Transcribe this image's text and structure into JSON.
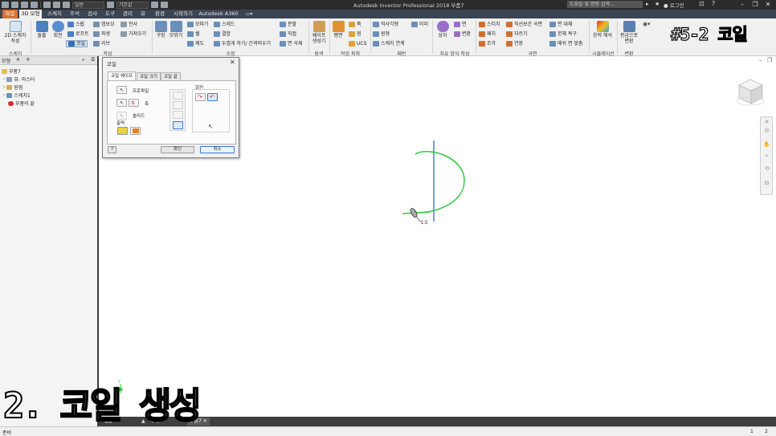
{
  "titlebar": {
    "app_title": "Autodesk Inventor Professional 2018    부품7",
    "material_combo": "일반",
    "appearance_combo": "기본값",
    "help_search_placeholder": "도움말 및 명령 검색...",
    "login_label": "로그인",
    "icons": [
      "file-icon",
      "save-icon",
      "undo-icon",
      "redo-icon",
      "home-icon",
      "folder-icon",
      "material-icon",
      "appearance-icon",
      "help-icon",
      "minimize-icon",
      "restore-icon",
      "close-icon"
    ]
  },
  "menubar": {
    "tabs": [
      "파일",
      "3D 모형",
      "스케치",
      "주석",
      "검사",
      "도구",
      "관리",
      "뷰",
      "환경",
      "시작하기",
      "Autodesk A360"
    ]
  },
  "ribbon": {
    "groups": {
      "sketch": {
        "label": "스케치",
        "sketch2d": "2D 스케치 작성"
      },
      "create": {
        "label": "작성",
        "extrude": "돌출",
        "revolve": "회전",
        "sweep": "스윕",
        "loft": "로프트",
        "coil": "코일",
        "emboss": "엠보싱",
        "derive": "파생",
        "rib": "리브",
        "decal": "전사",
        "import": "가져오기"
      },
      "modify": {
        "label": "수정",
        "hole": "구멍",
        "fillet": "모깎기",
        "chamfer": "모따기",
        "shell": "쉘",
        "draft": "제도",
        "thread": "스레드",
        "combine": "결합",
        "thicken": "두껍게 하기/ 간격띄우기",
        "split": "분할",
        "direct": "직접",
        "delete_face": "면 삭제"
      },
      "explore": {
        "label": "탐색",
        "shape_gen": "쉐이프 생성기"
      },
      "work_features": {
        "label": "작업 피쳐",
        "plane": "평면",
        "axis": "축",
        "point": "점",
        "ucs": "UCS"
      },
      "pattern": {
        "label": "패턴",
        "rect": "직사각형",
        "circ": "원형",
        "sketch_driven": "스케치 연계",
        "mirror": "미러"
      },
      "freeform": {
        "label": "자유 양식 작성",
        "box": "상자",
        "face": "면",
        "convert": "변환"
      },
      "surface": {
        "label": "곡면",
        "stitch": "스티치",
        "patch": "패치",
        "sculpt": "조각",
        "ruled": "직선보간 곡면",
        "trim": "자르기",
        "extend": "연장",
        "replace_face": "면 대체",
        "repair": "본체 복구",
        "mesh_fit": "메쉬 면 맞춤"
      },
      "simulation": {
        "label": "시뮬레이션",
        "stress": "응력 해석"
      },
      "convert": {
        "label": "변환",
        "to_sheetmetal": "판금으로 변환"
      }
    }
  },
  "brand_tag": "#5-2 코일",
  "browser": {
    "tabs": [
      "모형"
    ],
    "items": [
      {
        "label": "부품7"
      },
      {
        "label": "뷰: 마스터"
      },
      {
        "label": "원점"
      },
      {
        "label": "스케치1"
      },
      {
        "label": "부품의 끝"
      }
    ]
  },
  "dialog": {
    "title": "코일",
    "tabs": [
      "코일 쉐이프",
      "코일 크기",
      "코일 끝"
    ],
    "profile_label": "프로파일",
    "axis_label": "축",
    "solid_label": "솔리드",
    "output_label": "출력",
    "rotation_label": "회전",
    "ok": "확인",
    "cancel": "취소"
  },
  "viewport": {
    "dimension_value": "1.5"
  },
  "doc_tabs": [
    "내 홈",
    "부품7"
  ],
  "status": {
    "left": "준비",
    "page_a": "1",
    "page_b": "2"
  },
  "caption": "2. 코일 생성",
  "colors": {
    "accent": "#d8712f",
    "sketch_curve": "#2ecc40",
    "axis_line": "#1f5fbf",
    "menubar_bg": "#3b4453"
  }
}
